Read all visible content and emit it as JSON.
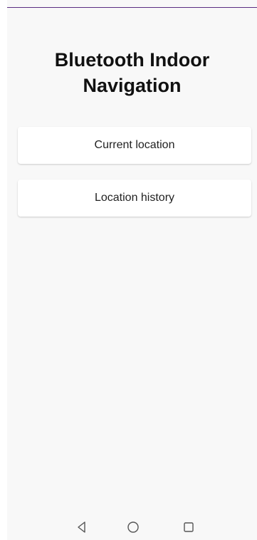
{
  "app": {
    "title": "Bluetooth Indoor Navigation"
  },
  "buttons": {
    "current_location": "Current location",
    "location_history": "Location history"
  },
  "system_nav": {
    "back_icon": "back-triangle-icon",
    "home_icon": "home-circle-icon",
    "recents_icon": "recents-square-icon"
  },
  "colors": {
    "accent": "#5a2d82",
    "background": "#f8f8f8",
    "card": "#ffffff"
  }
}
